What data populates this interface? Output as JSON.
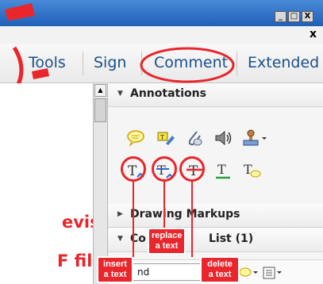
{
  "window": {
    "minimize": "_",
    "maximize": "□",
    "close": "X",
    "doc_close": "x"
  },
  "tabs": [
    {
      "label": "Tools"
    },
    {
      "label": "Sign"
    },
    {
      "label": "Comment"
    },
    {
      "label": "Extended"
    }
  ],
  "overlay": {
    "line1": "evise",
    "line2": "F file?"
  },
  "panel": {
    "annotations_label": "Annotations",
    "drawing_markups_label": "Drawing Markups",
    "comments_list_prefix": "Co",
    "comments_list_suffix": "List (1)",
    "search_value": "nd"
  },
  "callouts": {
    "replace": "replace\na text",
    "insert": "insert\na text",
    "delete": "delete\na text"
  },
  "colors": {
    "highlight_red": "#e8262c",
    "tab_text": "#1b4f8a"
  }
}
